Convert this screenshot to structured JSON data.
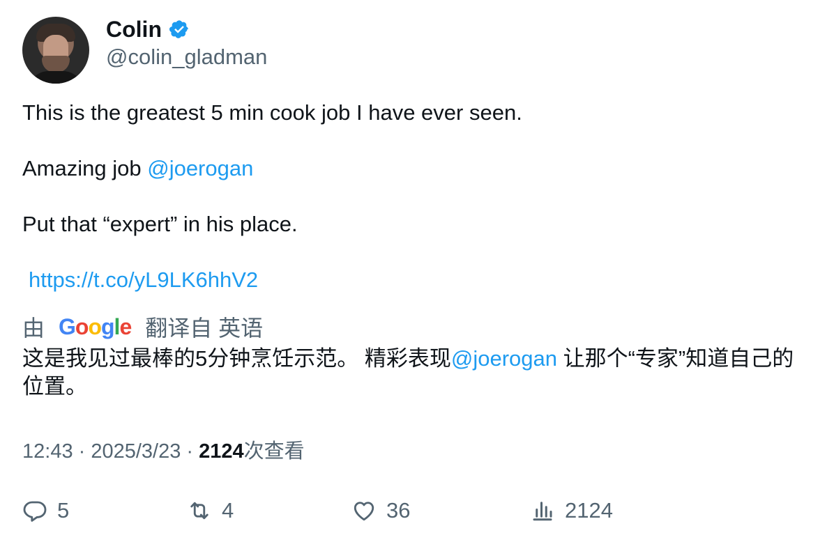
{
  "author": {
    "name": "Colin",
    "handle": "@colin_gladman",
    "verified_color": "#1d9bf0"
  },
  "tweet": {
    "line1": "This is the greatest 5 min cook job I have ever seen.",
    "line2_prefix": "Amazing job ",
    "line2_mention": "@joerogan",
    "line3": "Put that “expert” in his place.",
    "link": "https://t.co/yL9LK6hhV2"
  },
  "translation": {
    "by_prefix": "由",
    "google_letters": [
      "G",
      "o",
      "o",
      "g",
      "l",
      "e"
    ],
    "from_label": "翻译自 英语",
    "text_part1": "这是我见过最棒的5分钟烹饪示范。 精彩表现",
    "text_mention": "@joerogan",
    "text_part2": " 让那个“专家”知道自己的位置。"
  },
  "meta": {
    "time": "12:43",
    "separator": " · ",
    "date": "2025/3/23",
    "views_count": "2124",
    "views_label": "次查看"
  },
  "actions": {
    "replies": "5",
    "retweets": "4",
    "likes": "36",
    "views": "2124"
  },
  "icons": {
    "verified": "verified-badge-icon",
    "reply": "reply-icon",
    "retweet": "retweet-icon",
    "like": "heart-icon",
    "views": "analytics-icon"
  },
  "colors": {
    "link": "#1d9bf0",
    "secondary_text": "#536471",
    "primary_text": "#0f1419"
  }
}
